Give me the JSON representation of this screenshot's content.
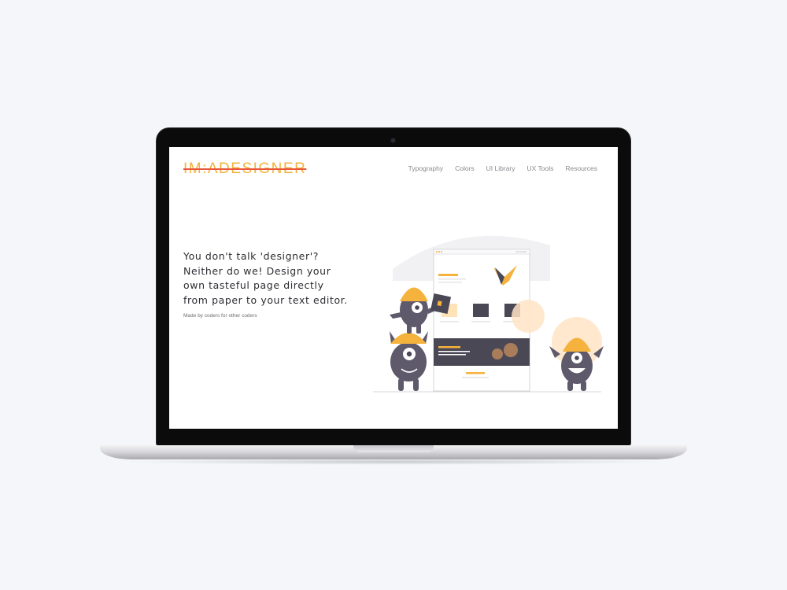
{
  "site": {
    "logo": "IM:ADESIGNER",
    "nav": [
      "Typography",
      "Colors",
      "UI Library",
      "UX Tools",
      "Resources"
    ],
    "hero": {
      "headline": "You don't talk 'designer'?\nNeither do we! Design your\nown tasteful page directly\nfrom paper to your text editor.",
      "subline": "Made by coders for other coders"
    }
  },
  "colors": {
    "accent": "#f5b23c",
    "strike": "#e8573c",
    "monster": "#5e5a6c",
    "text": "#2d2d33",
    "nav": "#8a8a8f"
  }
}
